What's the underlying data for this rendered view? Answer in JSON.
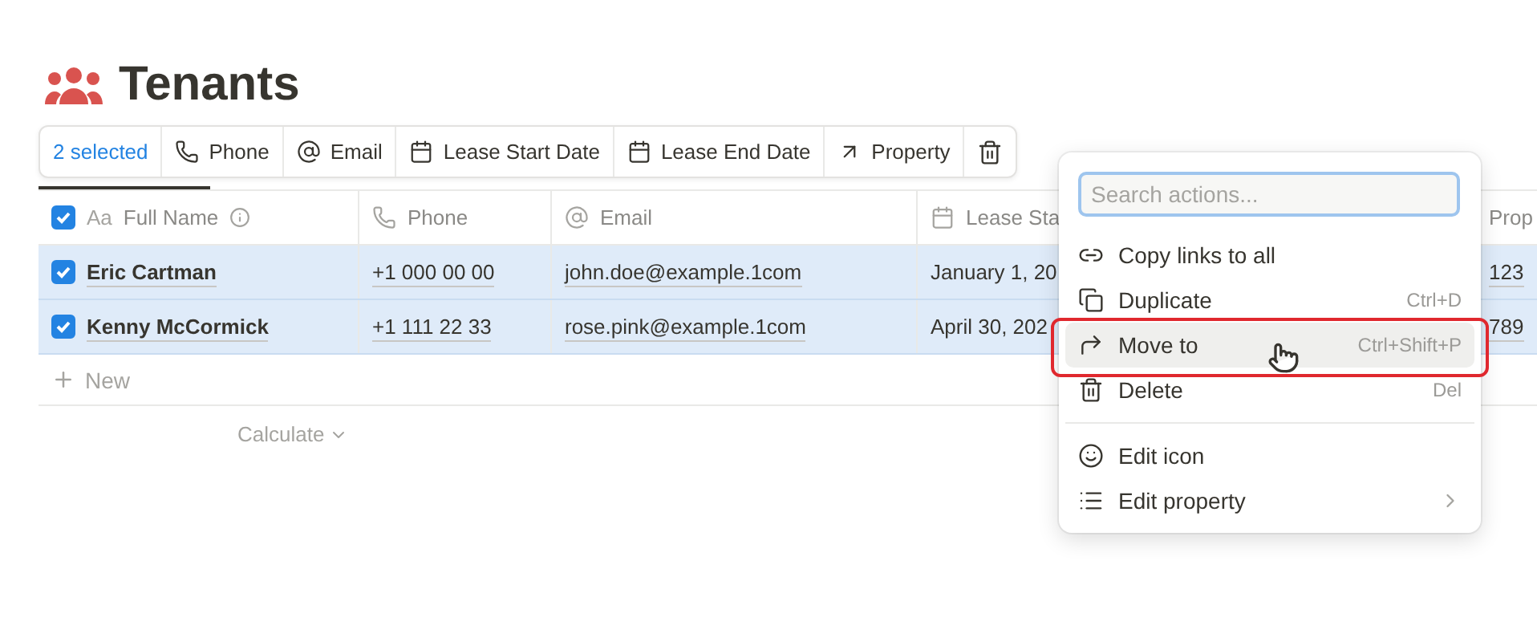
{
  "page": {
    "title": "Tenants"
  },
  "toolbar": [
    {
      "kind": "count",
      "label": "2 selected"
    },
    {
      "kind": "phone",
      "label": "Phone"
    },
    {
      "kind": "email",
      "label": "Email"
    },
    {
      "kind": "date",
      "label": "Lease Start Date"
    },
    {
      "kind": "date",
      "label": "Lease End Date"
    },
    {
      "kind": "relation",
      "label": "Property"
    },
    {
      "kind": "delete"
    }
  ],
  "table": {
    "all_checked": true,
    "columns": [
      {
        "kind": "title",
        "type_glyph": "Aa",
        "label": "Full Name",
        "info": true
      },
      {
        "kind": "phone",
        "label": "Phone"
      },
      {
        "kind": "email",
        "label": "Email"
      },
      {
        "kind": "date",
        "label": "Lease Sta"
      },
      {
        "kind": "relation",
        "label": "Prop"
      }
    ],
    "rows": [
      {
        "checked": true,
        "cells": [
          "Eric Cartman",
          "+1 000 00 00",
          "john.doe@example.1com",
          "January 1, 20",
          "123"
        ]
      },
      {
        "checked": true,
        "cells": [
          "Kenny McCormick",
          "+1 111 22 33",
          "rose.pink@example.1com",
          "April 30, 202",
          "789"
        ]
      }
    ],
    "new_label": "New",
    "calculate_label": "Calculate"
  },
  "menu": {
    "search_placeholder": "Search actions...",
    "groups": [
      [
        {
          "label": "Copy links to all",
          "selected": false
        },
        {
          "label": "Duplicate",
          "shortcut": "Ctrl+D",
          "selected": false
        },
        {
          "label": "Move to",
          "shortcut": "Ctrl+Shift+P",
          "selected": true
        },
        {
          "label": "Delete",
          "shortcut": "Del",
          "selected": false
        }
      ],
      [
        {
          "label": "Edit icon",
          "selected": false
        },
        {
          "label": "Edit property",
          "submenu": true,
          "selected": false
        }
      ]
    ]
  }
}
